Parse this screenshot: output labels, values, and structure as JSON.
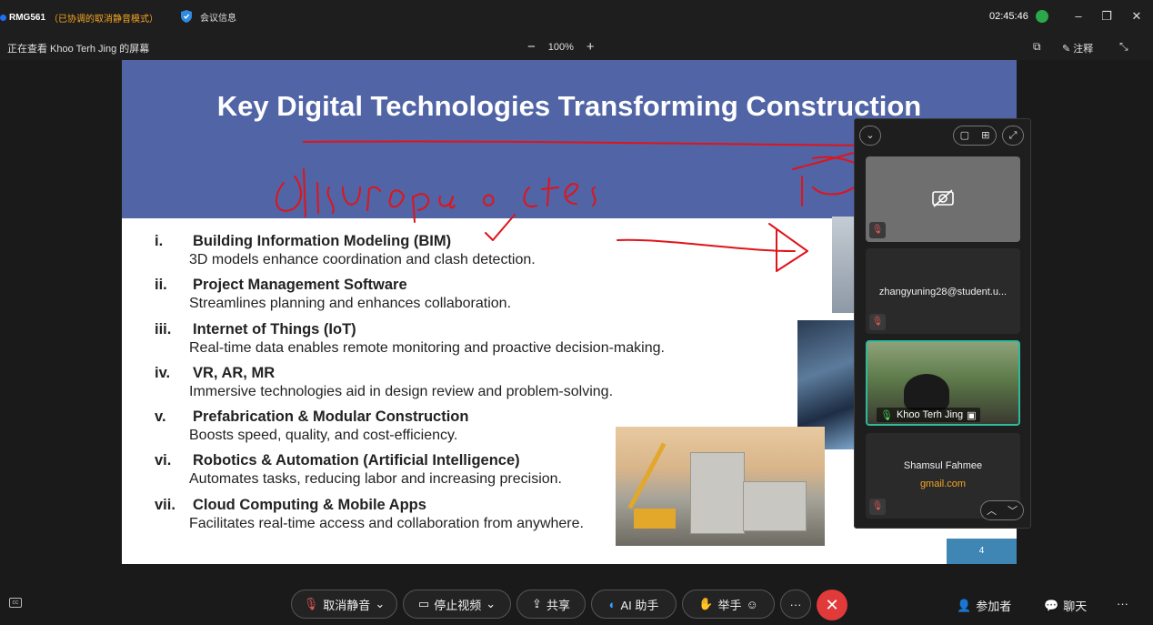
{
  "topbar": {
    "meeting_name": "RMG561",
    "muted_note": "（已协调的取消静音模式）",
    "info_label": "会议信息",
    "clock": "02:45:46"
  },
  "viewbar": {
    "viewing_label": "正在查看 Khoo Terh Jing 的屏幕",
    "zoom_minus": "−",
    "zoom_level": "100%",
    "zoom_plus": "+",
    "annotate_label": "注释"
  },
  "slide": {
    "title": "Key Digital Technologies Transforming Construction",
    "page_number": "4",
    "items": [
      {
        "num": "i.",
        "head": "Building Information Modeling (BIM)",
        "desc": "3D models enhance coordination and clash detection."
      },
      {
        "num": "ii.",
        "head": "Project Management Software",
        "desc": "Streamlines planning and enhances collaboration."
      },
      {
        "num": "iii.",
        "head": "Internet of Things (IoT)",
        "desc": "Real-time data enables remote monitoring and proactive decision-making."
      },
      {
        "num": "iv.",
        "head": "VR, AR, MR",
        "desc": "Immersive technologies aid in design review and problem-solving."
      },
      {
        "num": "v.",
        "head": "Prefabrication & Modular Construction",
        "desc": "Boosts speed, quality, and cost-efficiency."
      },
      {
        "num": "vi.",
        "head": "Robotics & Automation (Artificial Intelligence)",
        "desc": "Automates tasks, reducing labor and increasing precision."
      },
      {
        "num": "vii.",
        "head": "Cloud Computing & Mobile Apps",
        "desc": "Facilitates real-time access and collaboration from anywhere."
      }
    ]
  },
  "participants": {
    "tiles": [
      {
        "name": ""
      },
      {
        "name": "zhangyuning28@student.u..."
      },
      {
        "name": "Khoo Terh Jing"
      },
      {
        "name": "Shamsul Fahmee",
        "sub": "gmail.com"
      }
    ]
  },
  "controls": {
    "unmute": "取消静音",
    "stop_video": "停止视频",
    "share": "共享",
    "ai": "AI 助手",
    "raise_hand": "举手",
    "more": "···",
    "participants": "参加者",
    "chat": "聊天",
    "overflow": "···"
  },
  "colors": {
    "slide_header": "#5064a6",
    "end_call": "#e03a3a",
    "ink": "#e0141a",
    "active_tile_border": "#2fb89a"
  }
}
